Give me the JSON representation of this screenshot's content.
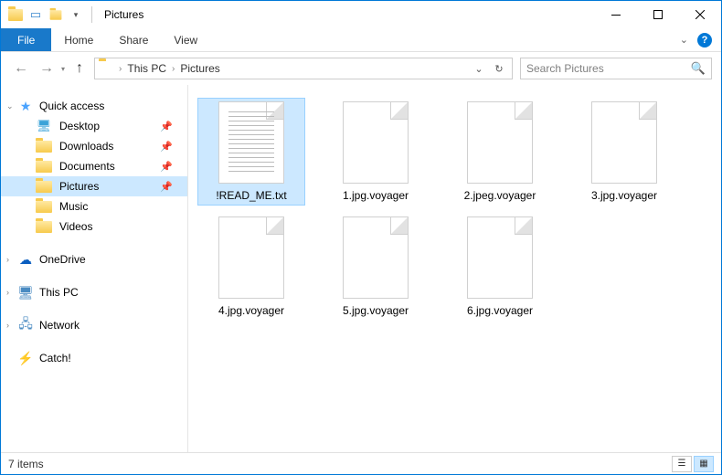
{
  "title": "Pictures",
  "ribbon": {
    "file": "File",
    "tabs": [
      "Home",
      "Share",
      "View"
    ]
  },
  "breadcrumb": [
    "This PC",
    "Pictures"
  ],
  "search": {
    "placeholder": "Search Pictures"
  },
  "sidebar": {
    "quickaccess": {
      "label": "Quick access",
      "items": [
        {
          "label": "Desktop",
          "pinned": true
        },
        {
          "label": "Downloads",
          "pinned": true
        },
        {
          "label": "Documents",
          "pinned": true
        },
        {
          "label": "Pictures",
          "pinned": true,
          "selected": true
        },
        {
          "label": "Music",
          "pinned": false
        },
        {
          "label": "Videos",
          "pinned": false
        }
      ]
    },
    "onedrive": {
      "label": "OneDrive"
    },
    "thispc": {
      "label": "This PC"
    },
    "network": {
      "label": "Network"
    },
    "catch": {
      "label": "Catch!"
    }
  },
  "files": [
    {
      "name": "!READ_ME.txt",
      "type": "txt",
      "selected": true
    },
    {
      "name": "1.jpg.voyager",
      "type": "blank"
    },
    {
      "name": "2.jpeg.voyager",
      "type": "blank"
    },
    {
      "name": "3.jpg.voyager",
      "type": "blank"
    },
    {
      "name": "4.jpg.voyager",
      "type": "blank"
    },
    {
      "name": "5.jpg.voyager",
      "type": "blank"
    },
    {
      "name": "6.jpg.voyager",
      "type": "blank"
    }
  ],
  "status": {
    "count": "7 items"
  }
}
